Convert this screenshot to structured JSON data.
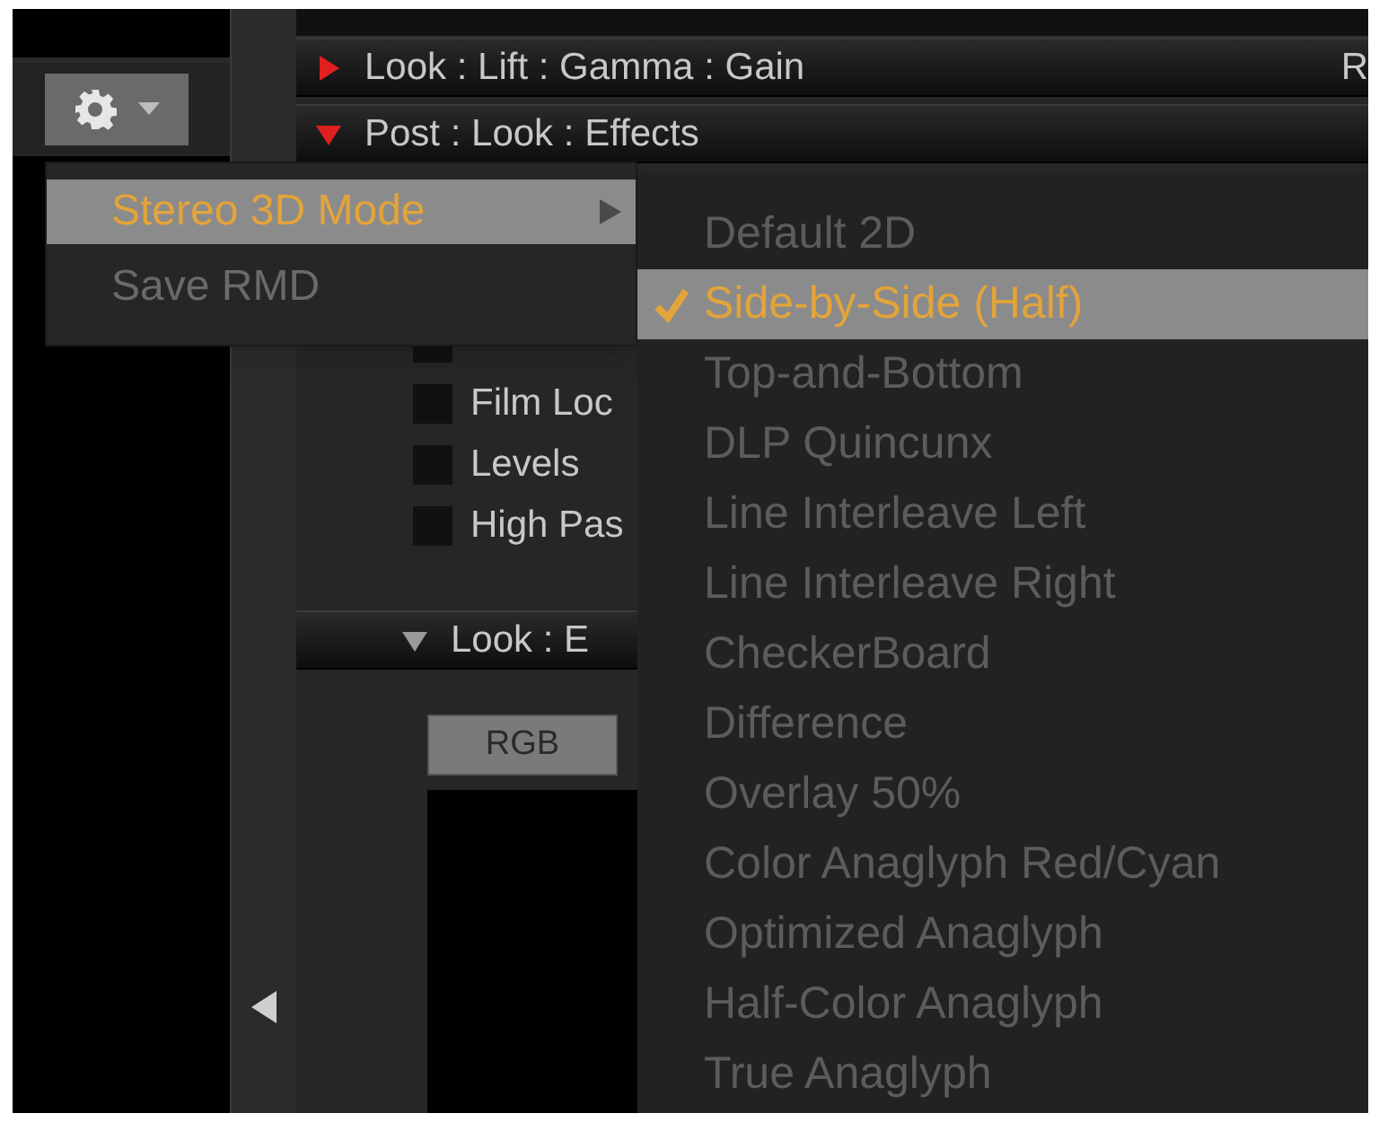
{
  "sections": [
    {
      "title": "Look : Lift : Gamma : Gain",
      "expanded": false,
      "color": "#e0201e",
      "trailing": "R"
    },
    {
      "title": "Post : Look : Effects",
      "expanded": true,
      "color": "#e0201e",
      "effects": [
        {
          "checked": false
        },
        {
          "label": "Film Loc",
          "checked": false
        },
        {
          "label": "Levels",
          "checked": false
        },
        {
          "label": "High Pas",
          "checked": false
        }
      ]
    },
    {
      "title": "Look : E",
      "expanded": true,
      "color": "#9a9a9a",
      "tabs": [
        {
          "label": "RGB",
          "selected": true
        }
      ]
    }
  ],
  "menu": [
    {
      "label": "Stereo 3D Mode",
      "selected": true,
      "has_submenu": true
    },
    {
      "label": "Save RMD",
      "selected": false,
      "has_submenu": false
    }
  ],
  "submenu": [
    {
      "label": "Default 2D",
      "selected": false,
      "checked": false
    },
    {
      "label": "Side-by-Side (Half)",
      "selected": true,
      "checked": true
    },
    {
      "label": "Top-and-Bottom",
      "selected": false,
      "checked": false
    },
    {
      "label": "DLP Quincunx",
      "selected": false,
      "checked": false
    },
    {
      "label": "Line Interleave Left",
      "selected": false,
      "checked": false
    },
    {
      "label": "Line Interleave Right",
      "selected": false,
      "checked": false
    },
    {
      "label": "CheckerBoard",
      "selected": false,
      "checked": false
    },
    {
      "label": "Difference",
      "selected": false,
      "checked": false
    },
    {
      "label": "Overlay 50%",
      "selected": false,
      "checked": false
    },
    {
      "label": "Color Anaglyph Red/Cyan",
      "selected": false,
      "checked": false
    },
    {
      "label": "Optimized Anaglyph",
      "selected": false,
      "checked": false
    },
    {
      "label": "Half-Color Anaglyph",
      "selected": false,
      "checked": false
    },
    {
      "label": "True Anaglyph",
      "selected": false,
      "checked": false
    }
  ]
}
